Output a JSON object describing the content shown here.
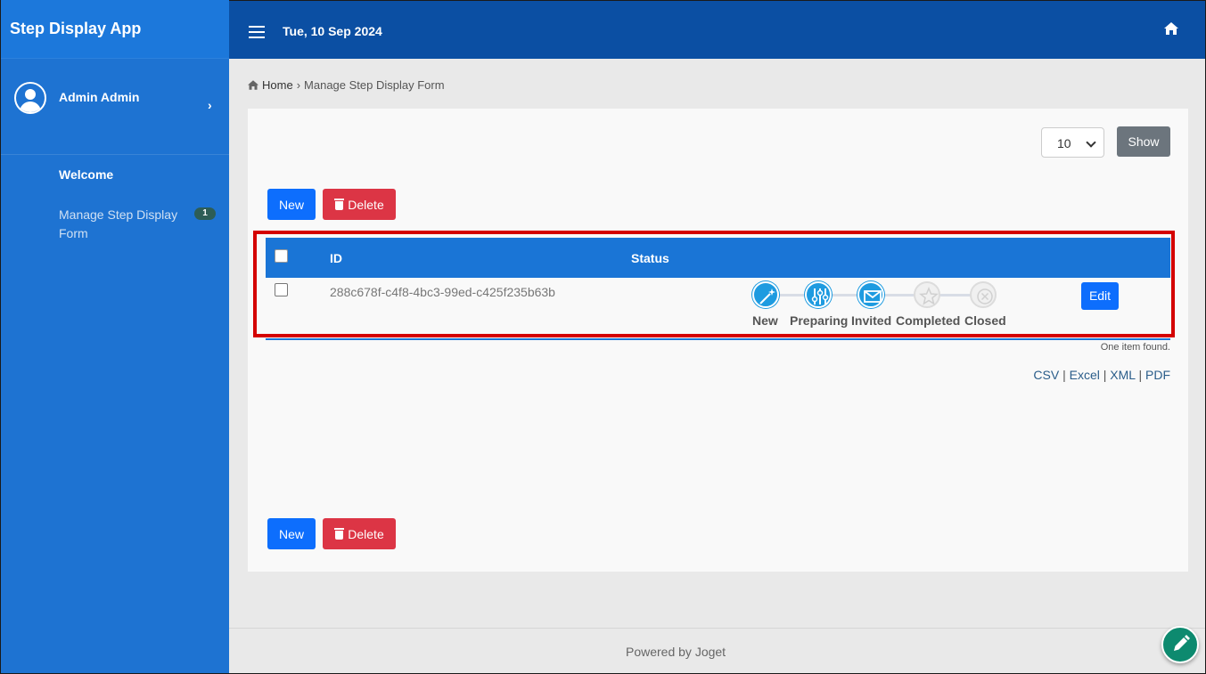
{
  "app": {
    "title": "Step Display App"
  },
  "header": {
    "date": "Tue, 10 Sep 2024",
    "home_icon": "home-icon",
    "menu_icon": "hamburger-icon"
  },
  "sidebar": {
    "user_name": "Admin Admin",
    "items": [
      {
        "label": "Welcome"
      },
      {
        "label": "Manage Step Display Form",
        "badge": "1"
      }
    ]
  },
  "breadcrumb": {
    "home": "Home",
    "separator": "›",
    "current": "Manage Step Display Form"
  },
  "toolbar": {
    "page_size": "10",
    "show_label": "Show",
    "new_label": "New",
    "delete_label": "Delete"
  },
  "table": {
    "headers": {
      "id": "ID",
      "status": "Status"
    },
    "rows": [
      {
        "id": "288c678f-c4f8-4bc3-99ed-c425f235b63b",
        "steps": [
          {
            "label": "New",
            "icon": "magic-wand-icon",
            "active": true
          },
          {
            "label": "Preparing",
            "icon": "sliders-icon",
            "active": true
          },
          {
            "label": "Invited",
            "icon": "envelope-icon",
            "active": true
          },
          {
            "label": "Completed",
            "icon": "star-icon",
            "active": false
          },
          {
            "label": "Closed",
            "icon": "close-circle-icon",
            "active": false
          }
        ],
        "edit_label": "Edit"
      }
    ],
    "found_text": "One item found."
  },
  "exports": [
    "CSV",
    "Excel",
    "XML",
    "PDF"
  ],
  "footer": {
    "text": "Powered by Joget"
  },
  "colors": {
    "sidebar": "#1e73d2",
    "header": "#0b4fa3",
    "primary": "#0d6efd",
    "danger": "#dc3545",
    "highlight_border": "#d40000"
  }
}
